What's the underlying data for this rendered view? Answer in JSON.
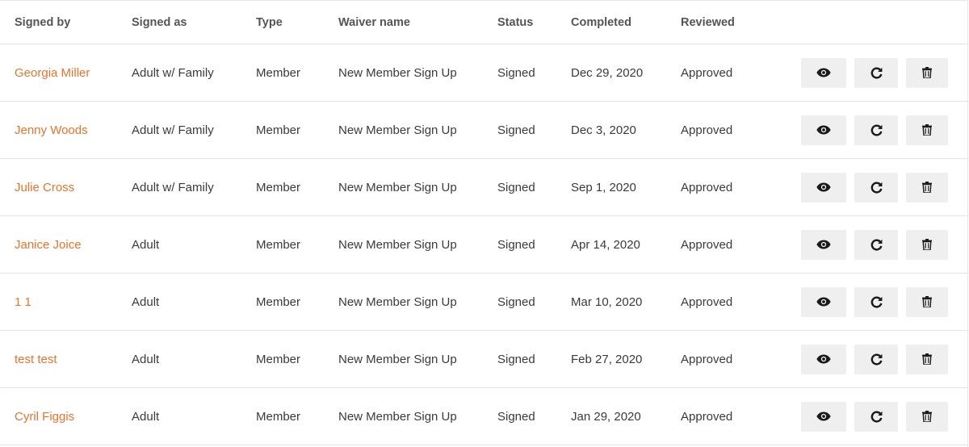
{
  "columns": {
    "signed_by": "Signed by",
    "signed_as": "Signed as",
    "type": "Type",
    "waiver_name": "Waiver name",
    "status": "Status",
    "completed": "Completed",
    "reviewed": "Reviewed"
  },
  "rows": [
    {
      "signed_by": "Georgia Miller",
      "signed_as": "Adult w/ Family",
      "type": "Member",
      "waiver_name": "New Member Sign Up",
      "status": "Signed",
      "completed": "Dec 29, 2020",
      "reviewed": "Approved"
    },
    {
      "signed_by": "Jenny Woods",
      "signed_as": "Adult w/ Family",
      "type": "Member",
      "waiver_name": "New Member Sign Up",
      "status": "Signed",
      "completed": "Dec 3, 2020",
      "reviewed": "Approved"
    },
    {
      "signed_by": "Julie Cross",
      "signed_as": "Adult w/ Family",
      "type": "Member",
      "waiver_name": "New Member Sign Up",
      "status": "Signed",
      "completed": "Sep 1, 2020",
      "reviewed": "Approved"
    },
    {
      "signed_by": "Janice Joice",
      "signed_as": "Adult",
      "type": "Member",
      "waiver_name": "New Member Sign Up",
      "status": "Signed",
      "completed": "Apr 14, 2020",
      "reviewed": "Approved"
    },
    {
      "signed_by": "1 1",
      "signed_as": "Adult",
      "type": "Member",
      "waiver_name": "New Member Sign Up",
      "status": "Signed",
      "completed": "Mar 10, 2020",
      "reviewed": "Approved"
    },
    {
      "signed_by": "test test",
      "signed_as": "Adult",
      "type": "Member",
      "waiver_name": "New Member Sign Up",
      "status": "Signed",
      "completed": "Feb 27, 2020",
      "reviewed": "Approved"
    },
    {
      "signed_by": "Cyril Figgis",
      "signed_as": "Adult",
      "type": "Member",
      "waiver_name": "New Member Sign Up",
      "status": "Signed",
      "completed": "Jan 29, 2020",
      "reviewed": "Approved"
    }
  ],
  "actions": {
    "view_icon": "eye-icon",
    "resend_icon": "refresh-icon",
    "delete_icon": "trash-icon"
  },
  "colors": {
    "link": "#e8732b",
    "button_bg": "#efefef",
    "divider": "#e4e4e4"
  }
}
